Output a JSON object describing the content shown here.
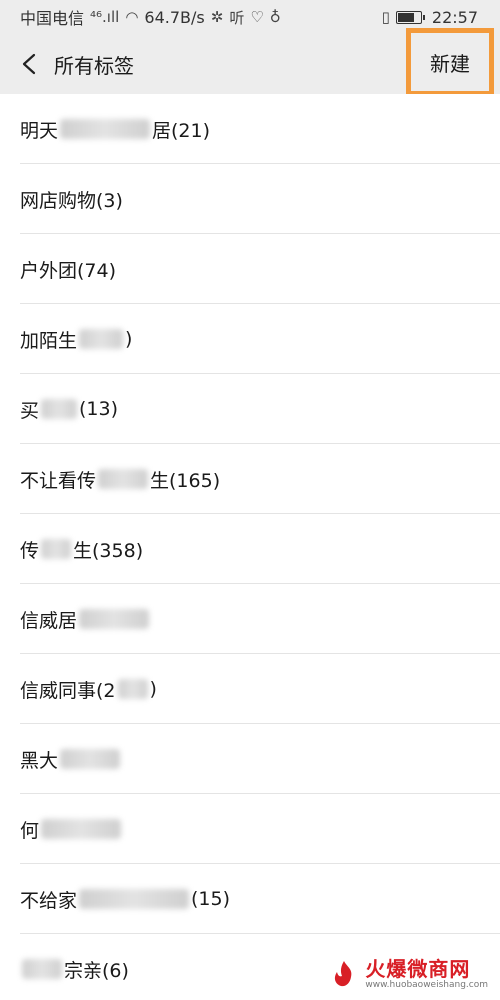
{
  "status_bar": {
    "carrier": "中国电信",
    "signal": "⁴⁶.ıll",
    "speed": "64.7B/s",
    "time": "22:57",
    "battery_level": 0.75
  },
  "nav": {
    "title": "所有标签",
    "new_label": "新建"
  },
  "tags": [
    {
      "pre": "明天",
      "post": "居(21)"
    },
    {
      "pre": "网店购物(3)",
      "post": ""
    },
    {
      "pre": "户外团(74)",
      "post": ""
    },
    {
      "pre": "加陌生",
      "post": ")"
    },
    {
      "pre": "买",
      "post": "(13)"
    },
    {
      "pre": "不让看传",
      "post": "生(165)"
    },
    {
      "pre": "传",
      "post": "生(358)"
    },
    {
      "pre": "信威居",
      "post": ""
    },
    {
      "pre": "信威同事(2",
      "post": ")"
    },
    {
      "pre": "黑大",
      "post": ""
    },
    {
      "pre": "何",
      "post": ""
    },
    {
      "pre": "不给家",
      "post": "(15)"
    },
    {
      "pre": "",
      "post": "宗亲(6)"
    }
  ],
  "watermark": {
    "title": "火爆微商网",
    "url": "www.huobaoweishang.com"
  },
  "colors": {
    "bar_bg": "#ededed",
    "highlight": "#f39a3b",
    "brand_red": "#d81f26"
  }
}
